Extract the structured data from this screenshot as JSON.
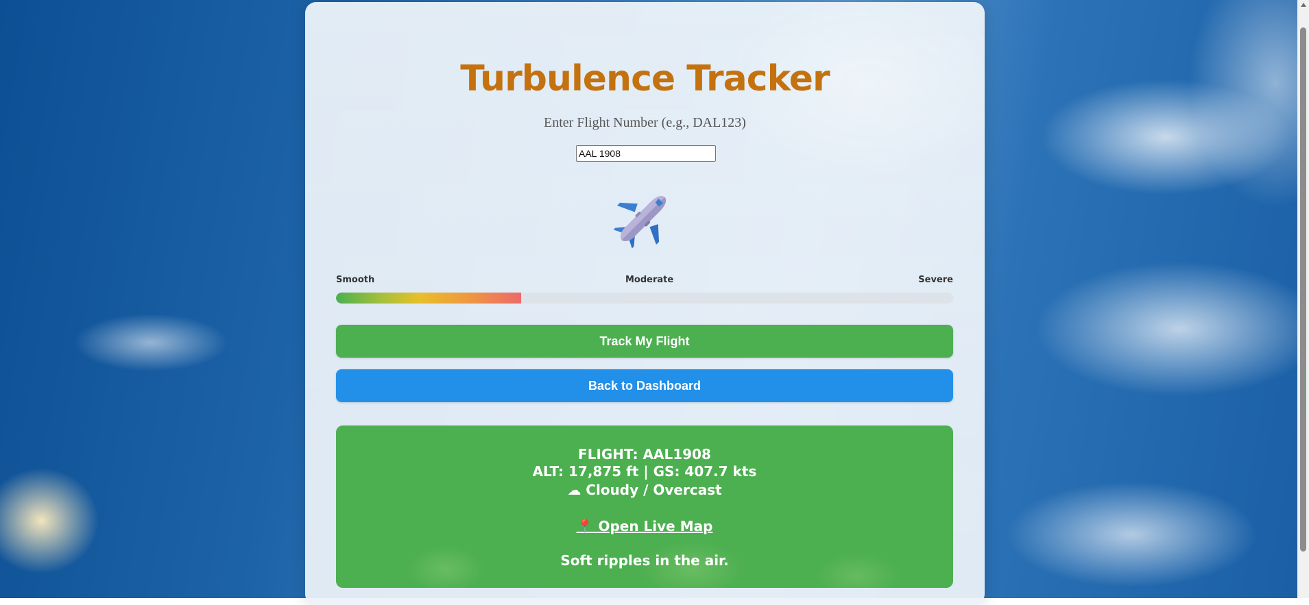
{
  "app": {
    "title": "Turbulence Tracker",
    "prompt": "Enter Flight Number (e.g., DAL123)"
  },
  "search": {
    "value": "AAL 1908",
    "icon": "airplane-icon"
  },
  "gauge": {
    "labels": {
      "low": "Smooth",
      "mid": "Moderate",
      "high": "Severe"
    },
    "level": 0.3
  },
  "buttons": {
    "track_label": "Track My Flight",
    "back_label": "Back to Dashboard"
  },
  "result": {
    "flight": "FLIGHT: AAL1908",
    "alt_speed": "ALT: 17,875 ft | GS: 407.7 kts",
    "weather_icon": "cloud-icon",
    "weather_glyph": "☁",
    "weather": "Cloudy / Overcast",
    "map_icon": "pin-icon",
    "map_glyph": "📍",
    "map_label": "Open Live Map",
    "note": "Soft ripples in the air."
  },
  "colors": {
    "title": "#c4720f",
    "track_button": "#4caf50",
    "back_button": "#2290e8",
    "result_panel": "#4caf50"
  }
}
